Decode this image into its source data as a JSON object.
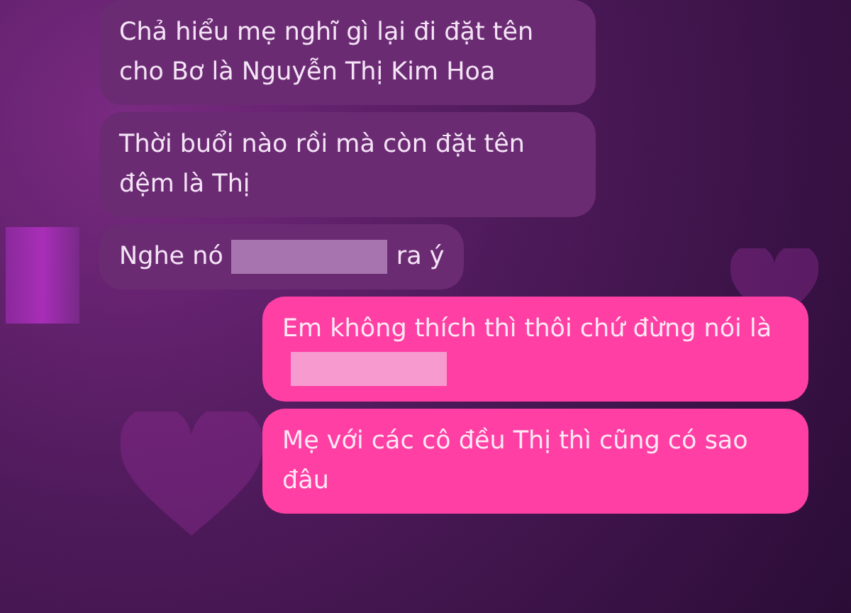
{
  "messages": [
    {
      "kind": "incoming",
      "segments": [
        {
          "kind": "text",
          "text": "Chả hiểu mẹ nghĩ gì lại đi đặt tên cho Bơ là Nguyễn Thị Kim Hoa"
        }
      ]
    },
    {
      "kind": "incoming",
      "segments": [
        {
          "kind": "text",
          "text": "Thời buổi nào rồi mà còn đặt tên đệm là Thị"
        }
      ]
    },
    {
      "kind": "incoming",
      "segments": [
        {
          "kind": "text",
          "text": "Nghe nó"
        },
        {
          "kind": "redacted"
        },
        {
          "kind": "text",
          "text": "ra ý"
        }
      ]
    },
    {
      "kind": "outgoing",
      "segments": [
        {
          "kind": "text",
          "text": "Em không thích thì thôi chứ đừng nói là"
        },
        {
          "kind": "redacted"
        }
      ]
    },
    {
      "kind": "outgoing",
      "segments": [
        {
          "kind": "text",
          "text": "Mẹ với các cô đều Thị thì cũng có sao đâu"
        }
      ]
    }
  ]
}
